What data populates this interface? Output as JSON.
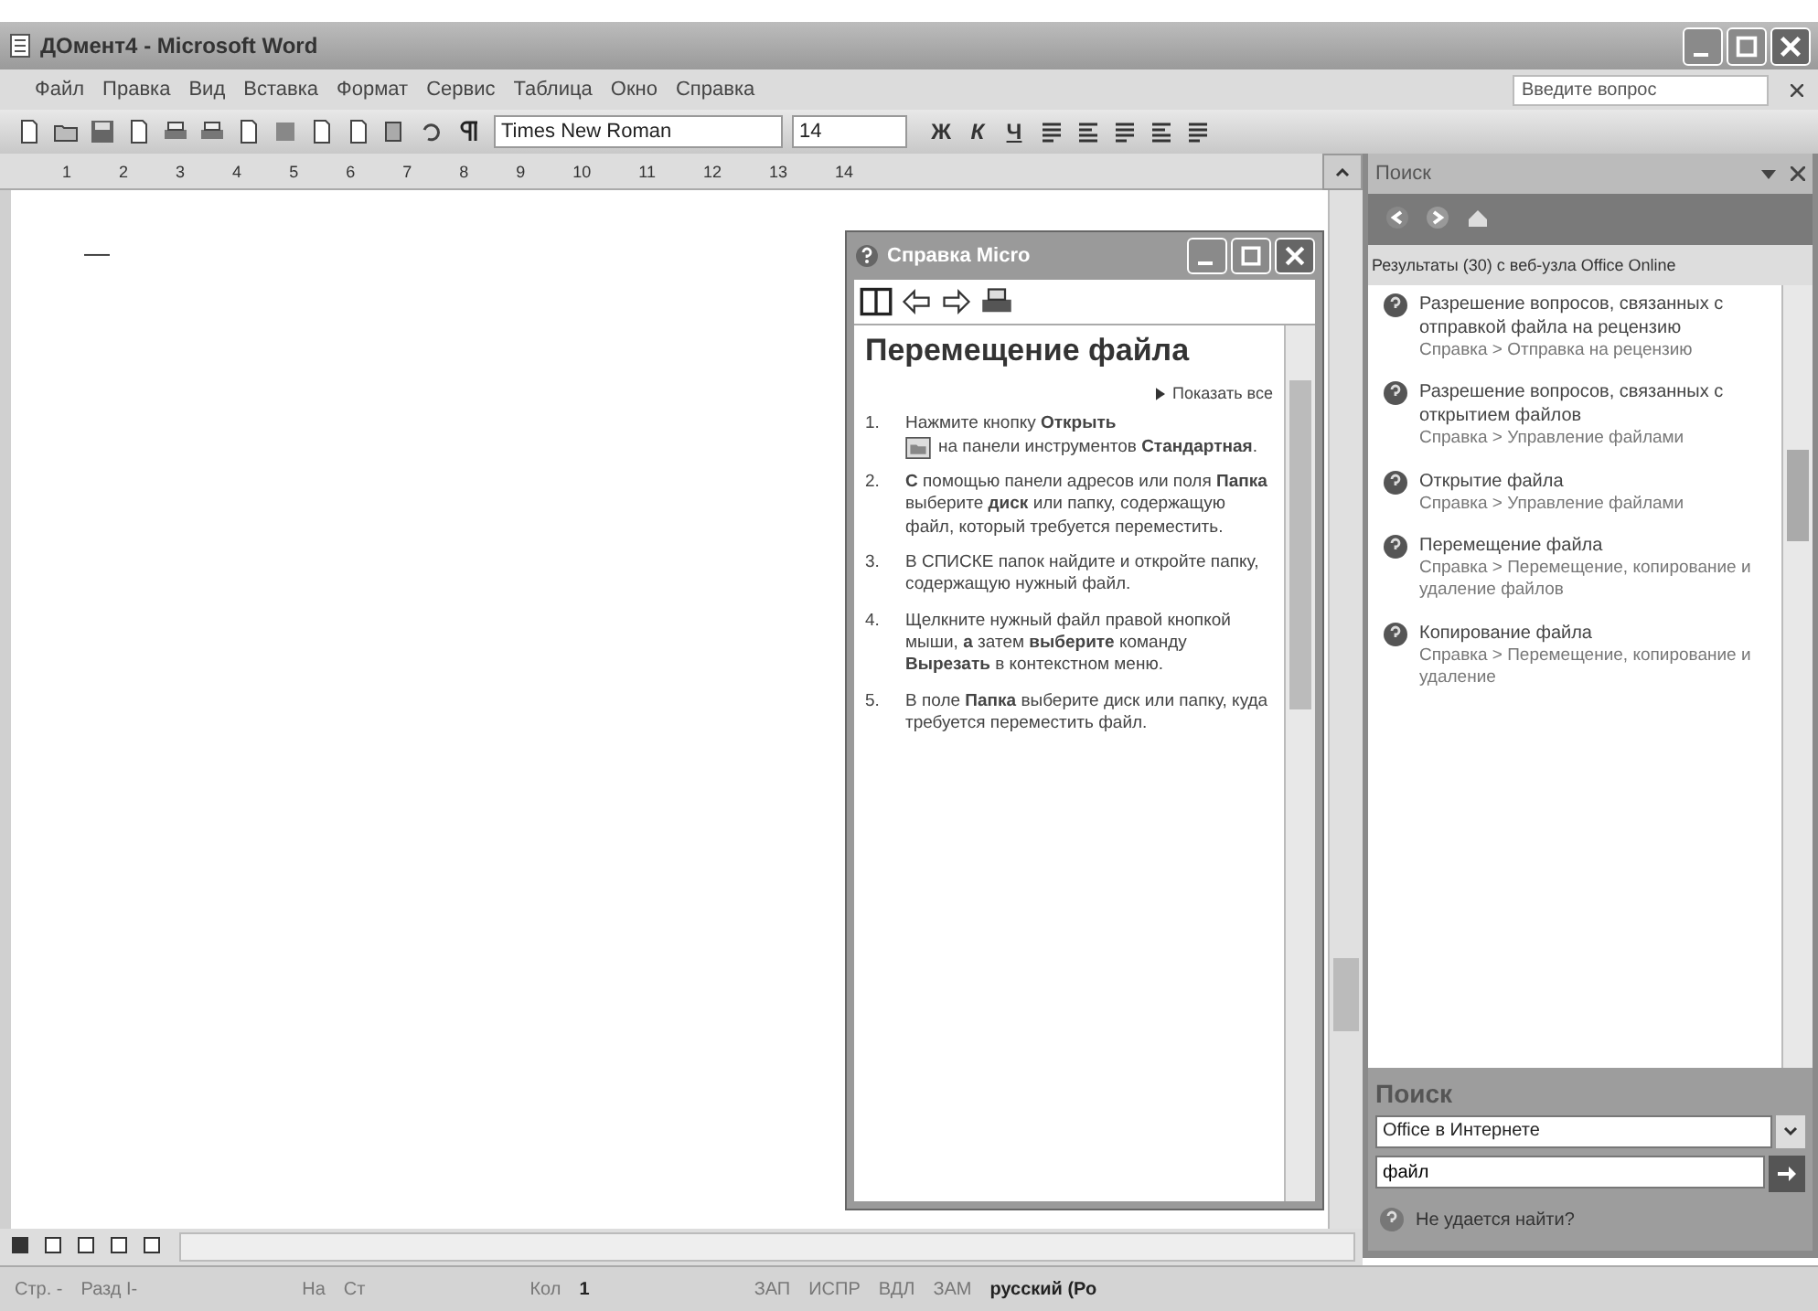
{
  "window": {
    "title": "ДОмент4 - Microsoft Word"
  },
  "menu": [
    "Файл",
    "Правка",
    "Вид",
    "Вставка",
    "Формат",
    "Сервис",
    "Таблица",
    "Окно",
    "Справка"
  ],
  "help_search": {
    "placeholder": "Введите вопрос"
  },
  "formatting": {
    "font": "Times New Roman",
    "size": "14",
    "format_buttons": [
      "Ж",
      "К",
      "Ч"
    ]
  },
  "ruler": [
    "1",
    "2",
    "3",
    "4",
    "5",
    "6",
    "7",
    "8",
    "9",
    "10",
    "11",
    "12",
    "13",
    "14"
  ],
  "document": {
    "text": "—"
  },
  "help_window": {
    "title": "Справка Micro",
    "heading": "Перемещение файла",
    "show_all": "Показать все",
    "steps": [
      {
        "number": "1.",
        "text": "Нажмите кнопку **Открыть**",
        "text_after": "на панели инструментов **Стандартная**."
      },
      {
        "number": "2.",
        "text": "**С** помощью панели адресов или поля **Папка** выберите **диск** или папку, содержащую файл, который требуется переместить."
      },
      {
        "number": "3.",
        "text": "В СПИСКЕ папок найдите и откройте папку, содержащую нужный файл."
      },
      {
        "number": "4.",
        "text": "Щелкните нужный файл правой кнопкой мыши, **а** затем **выберите** команду **Вырезать** в контекстном меню."
      },
      {
        "number": "5.",
        "text": "В поле **Папка** выберите диск или папку, куда требуется переместить файл."
      }
    ]
  },
  "task_pane": {
    "title": "Поиск",
    "results_header": "Результаты (30) с веб-узла Office Online",
    "results": [
      {
        "title": "Разрешение вопросов, связанных с отправкой файла на рецензию",
        "path": "Справка > Отправка на рецензию"
      },
      {
        "title": "Разрешение вопросов, связанных с открытием файлов",
        "path": "Справка > Управление файлами"
      },
      {
        "title": "Открытие файла",
        "path": "Справка > Управление файлами"
      },
      {
        "title": "Перемещение файла",
        "path": "Справка > Перемещение, копирование и удаление файлов"
      },
      {
        "title": "Копирование файла",
        "path": "Справка > Перемещение, копирование и удаление"
      }
    ],
    "search": {
      "title": "Поиск",
      "scope": "Office в Интернете",
      "query": "файл",
      "cant_find": "Не удается найти?"
    }
  },
  "status_bar": [
    "Стр. -",
    "Разд I-",
    "На",
    "Ст",
    "Кол",
    "1",
    "ЗАП",
    "ИСПР",
    "ВДЛ",
    "ЗАМ",
    "русский (Ро"
  ]
}
